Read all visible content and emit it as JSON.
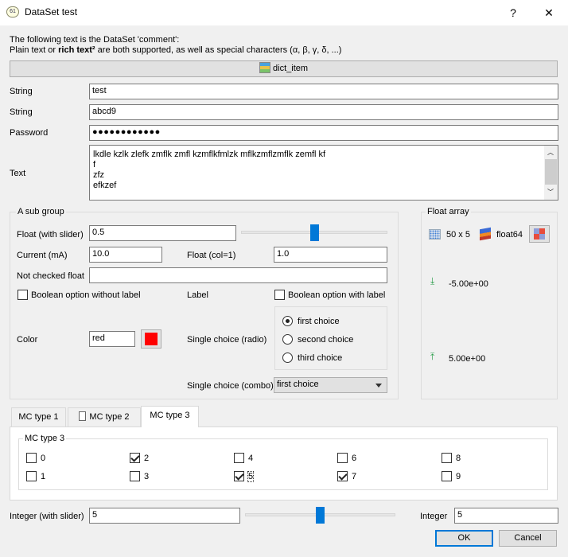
{
  "window": {
    "title": "DataSet test",
    "help": "?",
    "close": "✕"
  },
  "comment": {
    "line1": "The following text is the DataSet 'comment':",
    "line2_a": "Plain text or ",
    "line2_b": "rich text²",
    "line2_c": " are both supported, as well as special characters (α, β, γ, δ, ...)"
  },
  "dict_item": {
    "label": "dict_item"
  },
  "fields": {
    "string1": {
      "label": "String",
      "value": "test"
    },
    "string2": {
      "label": "String",
      "value": "abcd9"
    },
    "password": {
      "label": "Password",
      "value": "●●●●●●●●●●●●"
    },
    "text": {
      "label": "Text",
      "lines": [
        "lkdle kzlk zlefk zmflk zmfl kzmflkfmlzk mflkzmflzmflk zemfl kf",
        "f",
        "zfz",
        "efkzef"
      ]
    }
  },
  "subgroup": {
    "title": "A sub group",
    "float_slider": {
      "label": "Float (with slider)",
      "value": "0.5",
      "position": 0.5
    },
    "current": {
      "label": "Current (mA)",
      "value": "10.0"
    },
    "float_col": {
      "label": "Float (col=1)",
      "value": "1.0"
    },
    "not_checked": {
      "label": "Not checked float",
      "value": ""
    },
    "bool_no_label": {
      "label": "Boolean option without label",
      "checked": false
    },
    "label_text": "Label",
    "bool_with_label": {
      "label": "Boolean option with label",
      "checked": false
    },
    "color": {
      "label": "Color",
      "value": "red",
      "swatch": "#ff0000"
    },
    "radio": {
      "label": "Single choice (radio)",
      "options": [
        "first choice",
        "second choice",
        "third choice"
      ],
      "selected": 0
    },
    "combo": {
      "label": "Single choice (combo)",
      "value": "first choice"
    }
  },
  "float_array": {
    "title": "Float array",
    "shape": "50 x 5",
    "dtype": "float64",
    "min": "-5.00e+00",
    "max": "5.00e+00"
  },
  "tabs": {
    "items": [
      "MC type 1",
      "MC type 2",
      "MC type 3"
    ],
    "active": 2
  },
  "mc": {
    "title": "MC type 3",
    "boxes": [
      {
        "label": "0",
        "checked": false
      },
      {
        "label": "1",
        "checked": false
      },
      {
        "label": "2",
        "checked": true
      },
      {
        "label": "3",
        "checked": false
      },
      {
        "label": "4",
        "checked": false
      },
      {
        "label": "5",
        "checked": true
      },
      {
        "label": "6",
        "checked": false
      },
      {
        "label": "7",
        "checked": true
      },
      {
        "label": "8",
        "checked": false
      },
      {
        "label": "9",
        "checked": false
      }
    ]
  },
  "integer_slider": {
    "label": "Integer (with slider)",
    "value": "5",
    "position": 0.5
  },
  "integer": {
    "label": "Integer",
    "value": "5"
  },
  "buttons": {
    "ok": "OK",
    "cancel": "Cancel"
  }
}
